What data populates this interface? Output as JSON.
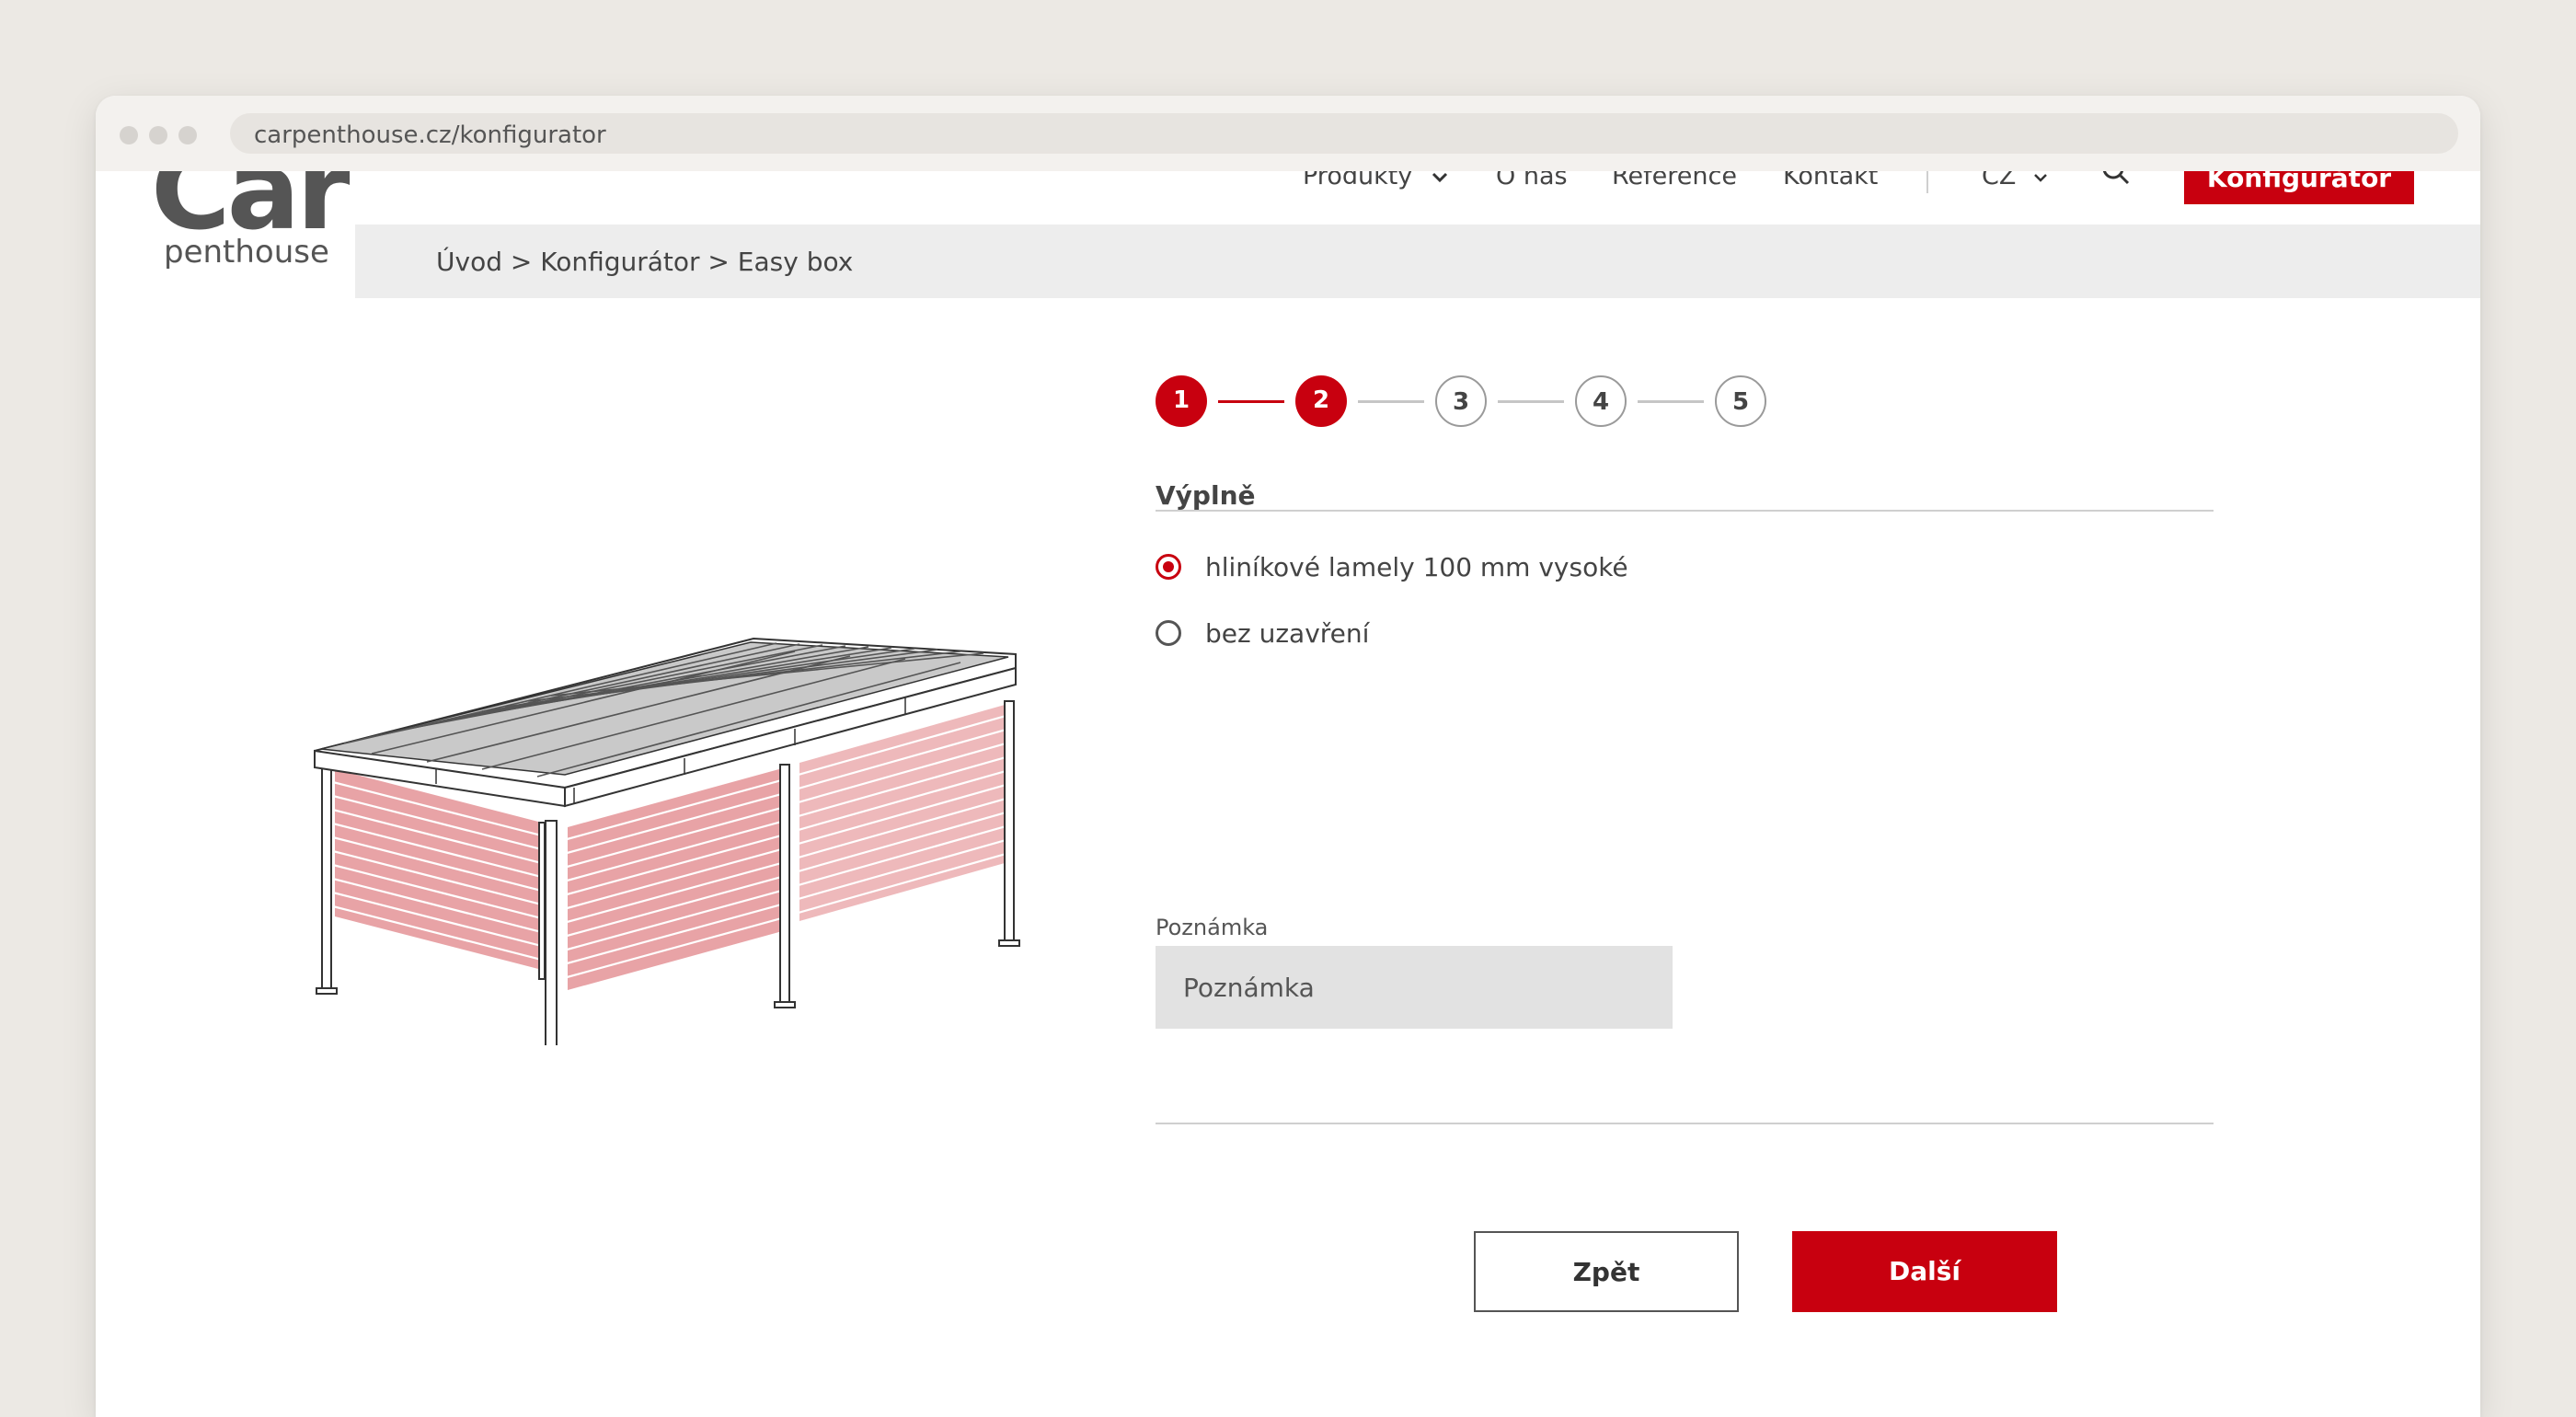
{
  "browser": {
    "url": "carpenthouse.cz/konfigurator"
  },
  "header": {
    "logo_main": "Car",
    "logo_sub": "penthouse",
    "nav": [
      {
        "label": "Produkty"
      },
      {
        "label": "O nás"
      },
      {
        "label": "Reference"
      },
      {
        "label": "Kontakt"
      }
    ],
    "language": "CZ",
    "cta_label": "Konfigurátor"
  },
  "breadcrumb": "Úvod > Konfigurátor > Easy box",
  "stepper": {
    "steps": [
      "1",
      "2",
      "3",
      "4",
      "5"
    ],
    "current_step": 2
  },
  "form": {
    "section_title": "Výplně",
    "options": [
      {
        "label": "hliníkové lamely 100 mm vysoké",
        "checked": true
      },
      {
        "label": "bez uzavření",
        "checked": false
      }
    ],
    "note_label": "Poznámka",
    "note_placeholder": "Poznámka",
    "note_value": ""
  },
  "actions": {
    "back_label": "Zpět",
    "next_label": "Další"
  },
  "colors": {
    "accent": "#C8000F",
    "lamella_fill": "#E8A3A6",
    "breadcrumb_bg": "#EDEDED",
    "input_bg": "#E2E2E2"
  }
}
